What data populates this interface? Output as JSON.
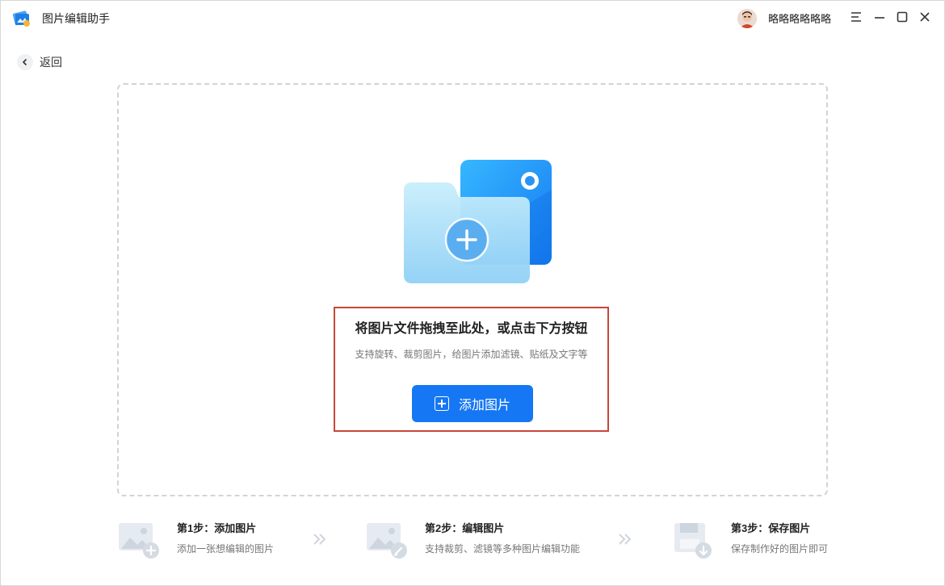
{
  "app": {
    "title": "图片编辑助手",
    "logo_icon": "app-logo-icon"
  },
  "user": {
    "name": "略略略略略略",
    "avatar_icon": "avatar-icon"
  },
  "window_controls": [
    "menu-icon",
    "minimize-icon",
    "maximize-icon",
    "close-icon"
  ],
  "nav": {
    "back_label": "返回"
  },
  "dropzone": {
    "title": "将图片文件拖拽至此处，或点击下方按钮",
    "subtitle": "支持旋转、裁剪图片，给图片添加滤镜、贴纸及文字等",
    "add_button_label": "添加图片",
    "illustration_icon": "folder-add-icon"
  },
  "steps": [
    {
      "title": "第1步：添加图片",
      "desc": "添加一张想编辑的图片",
      "icon": "image-add-icon"
    },
    {
      "title": "第2步：编辑图片",
      "desc": "支持裁剪、滤镜等多种图片编辑功能",
      "icon": "image-edit-icon"
    },
    {
      "title": "第3步：保存图片",
      "desc": "保存制作好的图片即可",
      "icon": "save-icon"
    }
  ],
  "colors": {
    "accent": "#1677f5",
    "highlight": "#c8463a",
    "dash": "#d3d3d6"
  }
}
